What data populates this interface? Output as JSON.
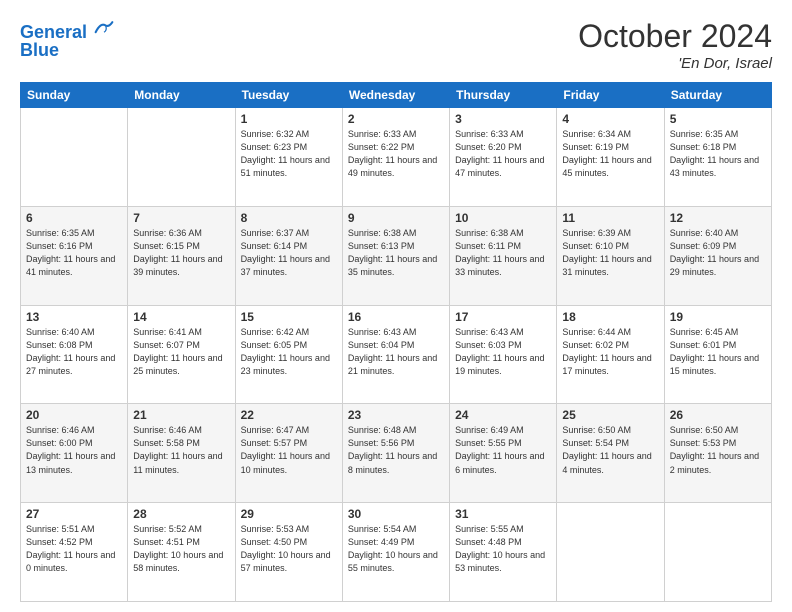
{
  "header": {
    "logo_line1": "General",
    "logo_line2": "Blue",
    "month": "October 2024",
    "location": "'En Dor, Israel"
  },
  "weekdays": [
    "Sunday",
    "Monday",
    "Tuesday",
    "Wednesday",
    "Thursday",
    "Friday",
    "Saturday"
  ],
  "weeks": [
    [
      {
        "day": "",
        "info": ""
      },
      {
        "day": "",
        "info": ""
      },
      {
        "day": "1",
        "info": "Sunrise: 6:32 AM\nSunset: 6:23 PM\nDaylight: 11 hours and 51 minutes."
      },
      {
        "day": "2",
        "info": "Sunrise: 6:33 AM\nSunset: 6:22 PM\nDaylight: 11 hours and 49 minutes."
      },
      {
        "day": "3",
        "info": "Sunrise: 6:33 AM\nSunset: 6:20 PM\nDaylight: 11 hours and 47 minutes."
      },
      {
        "day": "4",
        "info": "Sunrise: 6:34 AM\nSunset: 6:19 PM\nDaylight: 11 hours and 45 minutes."
      },
      {
        "day": "5",
        "info": "Sunrise: 6:35 AM\nSunset: 6:18 PM\nDaylight: 11 hours and 43 minutes."
      }
    ],
    [
      {
        "day": "6",
        "info": "Sunrise: 6:35 AM\nSunset: 6:16 PM\nDaylight: 11 hours and 41 minutes."
      },
      {
        "day": "7",
        "info": "Sunrise: 6:36 AM\nSunset: 6:15 PM\nDaylight: 11 hours and 39 minutes."
      },
      {
        "day": "8",
        "info": "Sunrise: 6:37 AM\nSunset: 6:14 PM\nDaylight: 11 hours and 37 minutes."
      },
      {
        "day": "9",
        "info": "Sunrise: 6:38 AM\nSunset: 6:13 PM\nDaylight: 11 hours and 35 minutes."
      },
      {
        "day": "10",
        "info": "Sunrise: 6:38 AM\nSunset: 6:11 PM\nDaylight: 11 hours and 33 minutes."
      },
      {
        "day": "11",
        "info": "Sunrise: 6:39 AM\nSunset: 6:10 PM\nDaylight: 11 hours and 31 minutes."
      },
      {
        "day": "12",
        "info": "Sunrise: 6:40 AM\nSunset: 6:09 PM\nDaylight: 11 hours and 29 minutes."
      }
    ],
    [
      {
        "day": "13",
        "info": "Sunrise: 6:40 AM\nSunset: 6:08 PM\nDaylight: 11 hours and 27 minutes."
      },
      {
        "day": "14",
        "info": "Sunrise: 6:41 AM\nSunset: 6:07 PM\nDaylight: 11 hours and 25 minutes."
      },
      {
        "day": "15",
        "info": "Sunrise: 6:42 AM\nSunset: 6:05 PM\nDaylight: 11 hours and 23 minutes."
      },
      {
        "day": "16",
        "info": "Sunrise: 6:43 AM\nSunset: 6:04 PM\nDaylight: 11 hours and 21 minutes."
      },
      {
        "day": "17",
        "info": "Sunrise: 6:43 AM\nSunset: 6:03 PM\nDaylight: 11 hours and 19 minutes."
      },
      {
        "day": "18",
        "info": "Sunrise: 6:44 AM\nSunset: 6:02 PM\nDaylight: 11 hours and 17 minutes."
      },
      {
        "day": "19",
        "info": "Sunrise: 6:45 AM\nSunset: 6:01 PM\nDaylight: 11 hours and 15 minutes."
      }
    ],
    [
      {
        "day": "20",
        "info": "Sunrise: 6:46 AM\nSunset: 6:00 PM\nDaylight: 11 hours and 13 minutes."
      },
      {
        "day": "21",
        "info": "Sunrise: 6:46 AM\nSunset: 5:58 PM\nDaylight: 11 hours and 11 minutes."
      },
      {
        "day": "22",
        "info": "Sunrise: 6:47 AM\nSunset: 5:57 PM\nDaylight: 11 hours and 10 minutes."
      },
      {
        "day": "23",
        "info": "Sunrise: 6:48 AM\nSunset: 5:56 PM\nDaylight: 11 hours and 8 minutes."
      },
      {
        "day": "24",
        "info": "Sunrise: 6:49 AM\nSunset: 5:55 PM\nDaylight: 11 hours and 6 minutes."
      },
      {
        "day": "25",
        "info": "Sunrise: 6:50 AM\nSunset: 5:54 PM\nDaylight: 11 hours and 4 minutes."
      },
      {
        "day": "26",
        "info": "Sunrise: 6:50 AM\nSunset: 5:53 PM\nDaylight: 11 hours and 2 minutes."
      }
    ],
    [
      {
        "day": "27",
        "info": "Sunrise: 5:51 AM\nSunset: 4:52 PM\nDaylight: 11 hours and 0 minutes."
      },
      {
        "day": "28",
        "info": "Sunrise: 5:52 AM\nSunset: 4:51 PM\nDaylight: 10 hours and 58 minutes."
      },
      {
        "day": "29",
        "info": "Sunrise: 5:53 AM\nSunset: 4:50 PM\nDaylight: 10 hours and 57 minutes."
      },
      {
        "day": "30",
        "info": "Sunrise: 5:54 AM\nSunset: 4:49 PM\nDaylight: 10 hours and 55 minutes."
      },
      {
        "day": "31",
        "info": "Sunrise: 5:55 AM\nSunset: 4:48 PM\nDaylight: 10 hours and 53 minutes."
      },
      {
        "day": "",
        "info": ""
      },
      {
        "day": "",
        "info": ""
      }
    ]
  ]
}
